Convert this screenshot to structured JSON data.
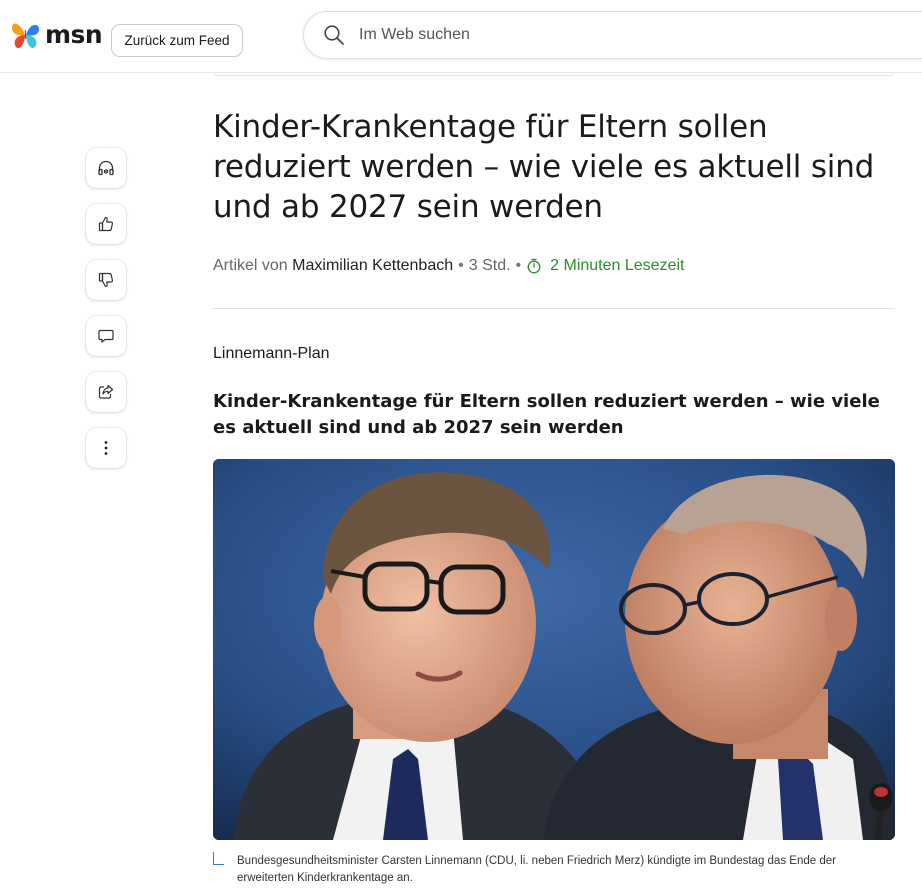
{
  "header": {
    "logo_text": "msn",
    "back_button": "Zurück zum Feed",
    "search_placeholder": "Im Web suchen"
  },
  "rail": {
    "items": [
      {
        "icon": "headphones-icon"
      },
      {
        "icon": "thumbs-up-icon"
      },
      {
        "icon": "thumbs-down-icon"
      },
      {
        "icon": "comment-icon"
      },
      {
        "icon": "share-icon"
      },
      {
        "icon": "more-vertical-icon"
      }
    ]
  },
  "article": {
    "title": "Kinder-Krankentage für Eltern sollen reduziert werden – wie viele es aktuell sind und ab 2027 sein werden",
    "byline_prefix": "Artikel von",
    "author": "Maximilian Kettenbach",
    "age": "3 Std.",
    "read_time": "2 Minuten Lesezeit",
    "kicker": "Linnemann-Plan",
    "subheadline": "Kinder-Krankentage für Eltern sollen reduziert werden – wie viele es aktuell sind und ab 2027 sein werden",
    "image_caption": "Bundesgesundheitsminister Carsten Linnemann (CDU, li. neben Friedrich Merz) kündigte im Bundestag das Ende der erweiterten Kinderkrankentage an."
  },
  "colors": {
    "accent_green": "#2e8b2e",
    "caption_accent": "#3a7bd5"
  }
}
